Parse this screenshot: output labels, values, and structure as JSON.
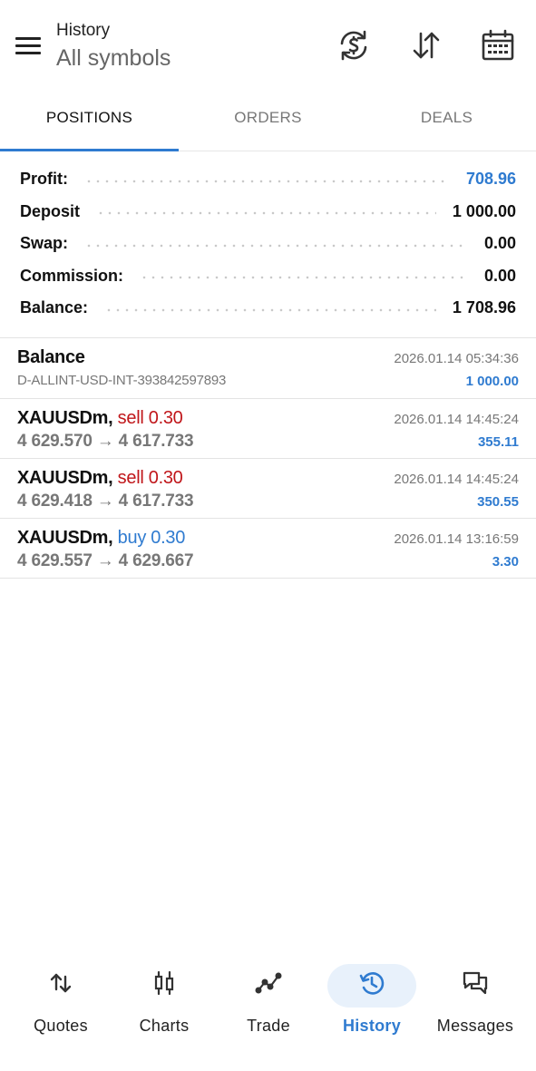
{
  "header": {
    "title": "History",
    "subtitle": "All symbols"
  },
  "tabs": [
    {
      "label": "POSITIONS",
      "active": true
    },
    {
      "label": "ORDERS",
      "active": false
    },
    {
      "label": "DEALS",
      "active": false
    }
  ],
  "summary": {
    "profit_label": "Profit:",
    "profit_value": "708.96",
    "deposit_label": "Deposit",
    "deposit_value": "1 000.00",
    "swap_label": "Swap:",
    "swap_value": "0.00",
    "commission_label": "Commission:",
    "commission_value": "0.00",
    "balance_label": "Balance:",
    "balance_value": "1 708.96"
  },
  "deals": [
    {
      "title": "Balance",
      "side": "",
      "volume": "",
      "detail": "D-ALLINT-USD-INT-393842597893",
      "time": "2026.01.14 05:34:36",
      "amount": "1 000.00"
    },
    {
      "title": "XAUUSDm,",
      "side": "sell",
      "volume": "0.30",
      "detail": "4 629.570 → 4 617.733",
      "time": "2026.01.14 14:45:24",
      "amount": "355.11"
    },
    {
      "title": "XAUUSDm,",
      "side": "sell",
      "volume": "0.30",
      "detail": "4 629.418 → 4 617.733",
      "time": "2026.01.14 14:45:24",
      "amount": "350.55"
    },
    {
      "title": "XAUUSDm,",
      "side": "buy",
      "volume": "0.30",
      "detail": "4 629.557 → 4 629.667",
      "time": "2026.01.14 13:16:59",
      "amount": "3.30"
    }
  ],
  "nav": [
    {
      "label": "Quotes",
      "icon": "quotes-arrows-icon",
      "active": false
    },
    {
      "label": "Charts",
      "icon": "candlestick-icon",
      "active": false
    },
    {
      "label": "Trade",
      "icon": "trade-line-icon",
      "active": false
    },
    {
      "label": "History",
      "icon": "history-clock-icon",
      "active": true
    },
    {
      "label": "Messages",
      "icon": "chat-bubbles-icon",
      "active": false
    }
  ],
  "colors": {
    "accent": "#2f7bd0",
    "sell": "#c0161a",
    "buy": "#2f7bd0",
    "muted": "#777777"
  }
}
